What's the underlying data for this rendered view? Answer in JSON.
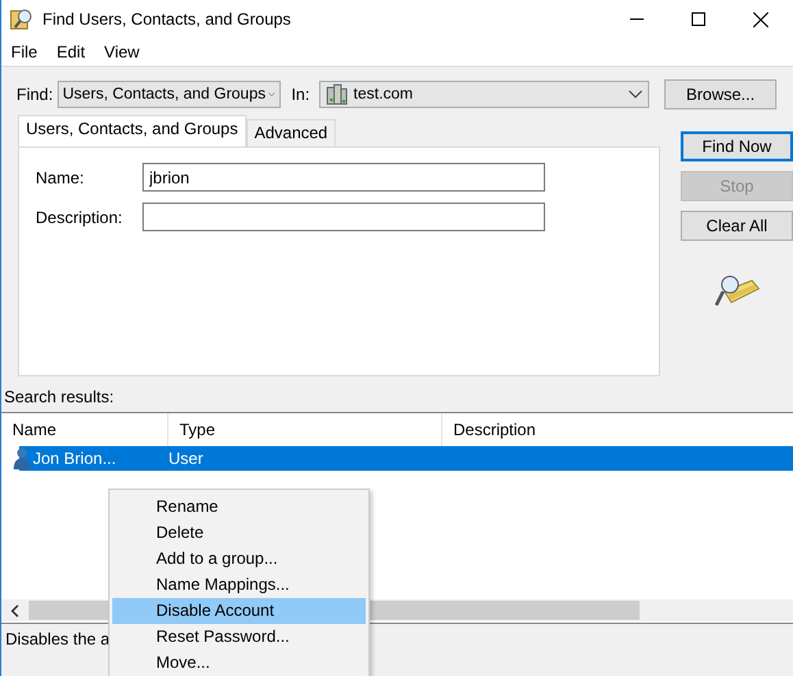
{
  "window": {
    "title": "Find Users, Contacts, and Groups"
  },
  "menu": [
    "File",
    "Edit",
    "View"
  ],
  "find": {
    "label": "Find:",
    "value": "Users, Contacts, and Groups"
  },
  "in": {
    "label": "In:",
    "value": "test.com"
  },
  "browse_button": "Browse...",
  "tabs": [
    {
      "label": "Users, Contacts, and Groups",
      "selected": true
    },
    {
      "label": "Advanced",
      "selected": false
    }
  ],
  "fields": [
    {
      "label": "Name:",
      "value": "jbrion"
    },
    {
      "label": "Description:"
    }
  ],
  "buttons": [
    {
      "label": "Find Now",
      "default": true,
      "disabled": false
    },
    {
      "label": "Stop",
      "default": false,
      "disabled": true
    },
    {
      "label": "Clear All",
      "default": false,
      "disabled": false
    }
  ],
  "results": {
    "label": "Search results:",
    "columns": [
      "Name",
      "Type",
      "Description"
    ],
    "rows": [
      {
        "name": "Jon Brion...",
        "type": "User",
        "selected": true
      }
    ]
  },
  "context_menu": [
    {
      "label": "Rename",
      "selected": false
    },
    {
      "label": "Delete",
      "selected": false
    },
    {
      "label": "Add to a group...",
      "selected": false
    },
    {
      "label": "Name Mappings...",
      "selected": false
    },
    {
      "label": "Disable Account",
      "selected": true
    },
    {
      "label": "Reset Password...",
      "selected": false
    },
    {
      "label": "Move...",
      "selected": false
    }
  ],
  "status_bar": "Disables the a"
}
